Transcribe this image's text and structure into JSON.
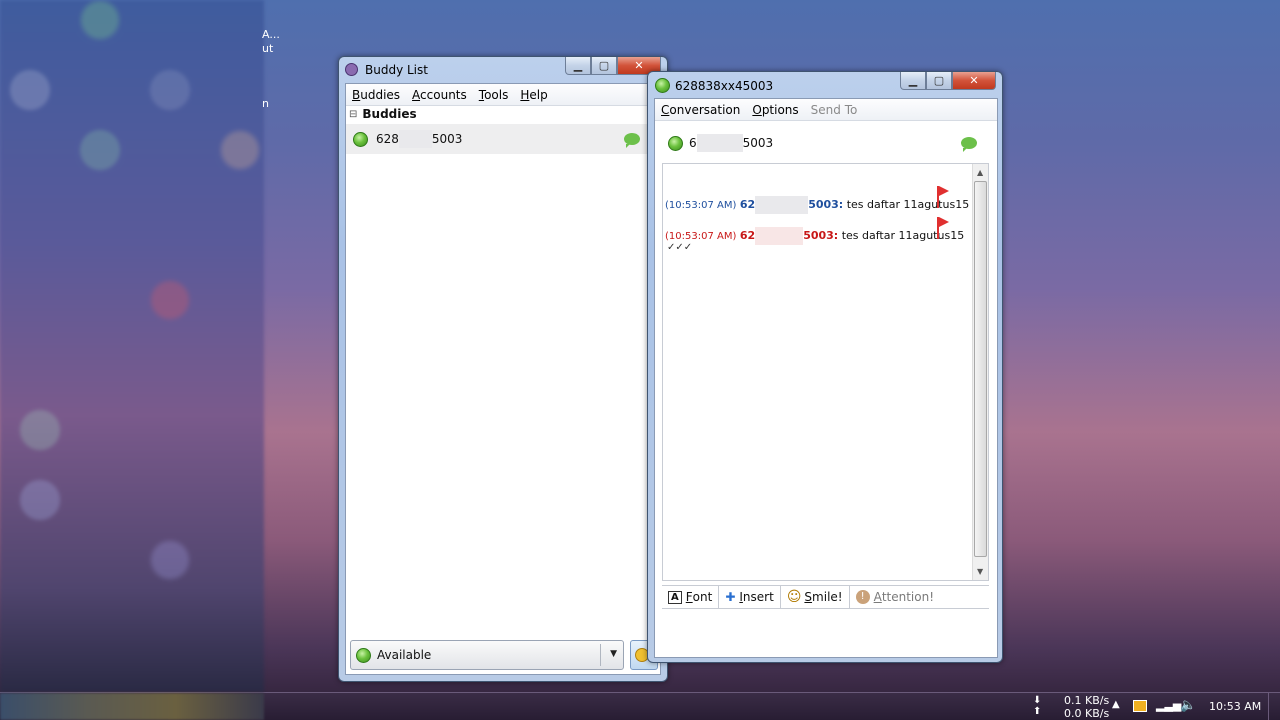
{
  "desktop": {
    "fragment1": "A...",
    "fragment2": "ut",
    "fragment3": "n"
  },
  "buddy_list": {
    "title": "Buddy List",
    "menu": [
      {
        "label": "Buddies",
        "ul": "B",
        "rest": "uddies"
      },
      {
        "label": "Accounts",
        "ul": "A",
        "rest": "ccounts"
      },
      {
        "label": "Tools",
        "ul": "T",
        "rest": "ools"
      },
      {
        "label": "Help",
        "ul": "H",
        "rest": "elp"
      }
    ],
    "group_name": "Buddies",
    "group_toggle": "⊟",
    "buddy": {
      "prefix": "628",
      "suffix": "5003"
    },
    "status": "Available",
    "dropdown_arrow": "▼"
  },
  "conversation": {
    "title": "628838xx45003",
    "menu": [
      {
        "label": "Conversation",
        "ul": "C",
        "rest": "onversation",
        "disabled": false
      },
      {
        "label": "Options",
        "ul": "O",
        "rest": "ptions",
        "disabled": false
      },
      {
        "label": "Send To",
        "ul": "",
        "rest": "Send To",
        "disabled": true
      }
    ],
    "contact": {
      "prefix": "6",
      "suffix": "5003"
    },
    "messages": [
      {
        "time": "(10:53:07 AM)",
        "sender_prefix": "62",
        "sender_suffix": "5003:",
        "text": "tes daftar 11agutus15",
        "color": "#1f4f9e"
      },
      {
        "time": "(10:53:07 AM)",
        "sender_prefix": "62",
        "sender_suffix": "5003:",
        "text": "tes daftar 11agutus15",
        "color": "#c81818"
      }
    ],
    "checks": "✓✓✓",
    "toolbar": [
      {
        "icon": "A",
        "ul": "F",
        "rest": "ont",
        "name": "font"
      },
      {
        "icon": "✚",
        "ul": "I",
        "rest": "nsert",
        "name": "insert"
      },
      {
        "icon": "☺",
        "ul": "S",
        "rest": "mile!",
        "name": "smile"
      },
      {
        "icon": "!",
        "ul": "A",
        "rest": "ttention!",
        "name": "attention"
      }
    ]
  },
  "tray": {
    "upload": "0.1 KB/s",
    "download": "0.0 KB/s",
    "clock": "10:53 AM"
  },
  "colors": {
    "status_green": "#6cc23e",
    "flag_red": "#e03030"
  }
}
